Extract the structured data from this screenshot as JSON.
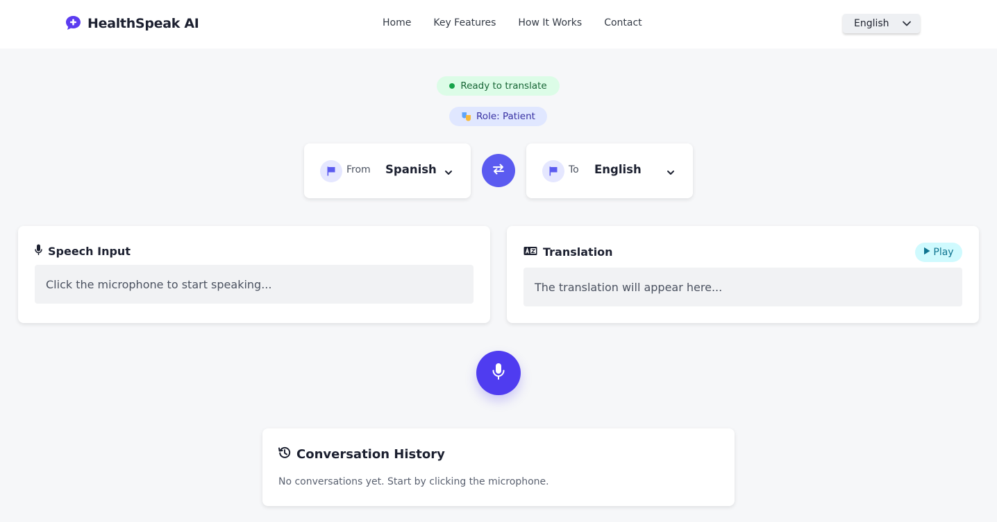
{
  "header": {
    "logo_text": "HealthSpeak AI",
    "nav": [
      "Home",
      "Key Features",
      "How It Works",
      "Contact"
    ],
    "language_selected": "English"
  },
  "status": {
    "ready_text": "Ready to translate",
    "role_text": "Role: Patient"
  },
  "languages": {
    "from_label": "From",
    "from_value": "Spanish",
    "to_label": "To",
    "to_value": "English"
  },
  "speech_panel": {
    "title": "Speech Input",
    "placeholder": "Click the microphone to start speaking..."
  },
  "translation_panel": {
    "title": "Translation",
    "placeholder": "The translation will appear here...",
    "play_label": "Play"
  },
  "history": {
    "title": "Conversation History",
    "empty_text": "No conversations yet. Start by clicking the microphone."
  },
  "colors": {
    "primary": "#5b5bf0",
    "mic": "#4f3cf0",
    "ready_bg": "#dcfce7",
    "ready_text": "#166534",
    "role_bg": "#e0e7ff",
    "play_bg": "#cffafe"
  },
  "icons": {
    "logo": "chat-plus-icon",
    "flag": "flag-icon",
    "swap": "swap-arrows-icon",
    "mic": "microphone-icon",
    "translate": "translate-icon",
    "play": "play-icon",
    "history": "history-icon",
    "role": "theater-masks-icon"
  }
}
